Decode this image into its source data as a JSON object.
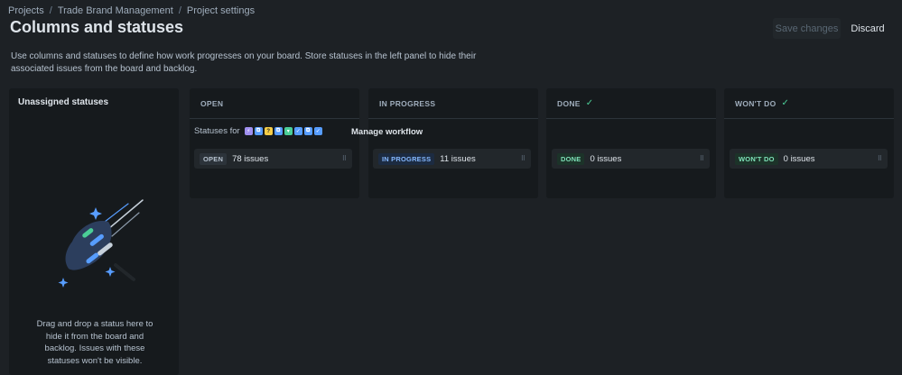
{
  "breadcrumb": [
    "Projects",
    "Trade Brand Management",
    "Project settings"
  ],
  "title": "Columns and statuses",
  "actions": {
    "save": "Save changes",
    "discard": "Discard"
  },
  "description": "Use columns and statuses to define how work progresses on your board. Store statuses in the left panel to hide their associated issues from the board and backlog.",
  "unassigned": {
    "heading": "Unassigned statuses",
    "hint": "Drag and drop a status here to hide it from the board and backlog. Issues with these statuses won't be visible."
  },
  "columns": [
    {
      "name": "OPEN",
      "done": false
    },
    {
      "name": "IN PROGRESS",
      "done": false
    },
    {
      "name": "DONE",
      "done": true
    },
    {
      "name": "WON'T DO",
      "done": true
    }
  ],
  "workflow": {
    "label": "Statuses for",
    "issue_type_icons": [
      "epic-icon",
      "subtask-icon",
      "question-icon",
      "subtask-icon",
      "story-icon",
      "task-icon",
      "subtask-icon",
      "task-icon"
    ],
    "manage": "Manage workflow"
  },
  "statuses": [
    {
      "lozenge": "OPEN",
      "count": "78 issues",
      "color": "#2c333a",
      "text_color": "#b6c2cf"
    },
    {
      "lozenge": "IN PROGRESS",
      "count": "11 issues",
      "color": "#1c2b41",
      "text_color": "#85b8ff"
    },
    {
      "lozenge": "DONE",
      "count": "0 issues",
      "color": "#1c3329",
      "text_color": "#7ee2b8"
    },
    {
      "lozenge": "WON'T DO",
      "count": "0 issues",
      "color": "#1c3329",
      "text_color": "#7ee2b8"
    }
  ],
  "colors": {
    "background": "#1d2125",
    "panel": "#161a1d",
    "card": "#22272b",
    "accent_green": "#4bce97"
  }
}
